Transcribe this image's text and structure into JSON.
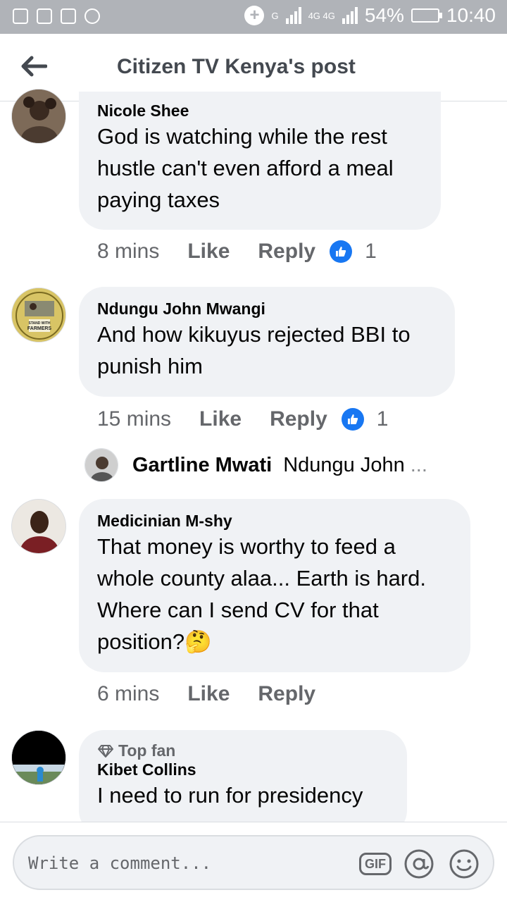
{
  "status_bar": {
    "network_1": "G",
    "network_2": "4G 4G",
    "battery": "54%",
    "battery_level": 0.54,
    "time": "10:40"
  },
  "header": {
    "title": "Citizen TV Kenya's post",
    "back_icon": "arrow-left-icon"
  },
  "comments": [
    {
      "author": "Nicole Shee",
      "text_lines": [
        "God is watching while the rest",
        "hustle can't even afford a meal",
        "paying taxes"
      ],
      "time": "8 mins",
      "like_label": "Like",
      "reply_label": "Reply",
      "reaction_count": "1"
    },
    {
      "author": "Ndungu John Mwangi",
      "avatar_text": [
        "STAND WITH",
        "FARMERS"
      ],
      "text_lines": [
        "And how kikuyus rejected BBI to",
        "punish him"
      ],
      "time": "15 mins",
      "like_label": "Like",
      "reply_label": "Reply",
      "reaction_count": "1",
      "reply_preview": {
        "author": "Gartline Mwati",
        "snippet": "Ndungu John",
        "ellipsis": "..."
      }
    },
    {
      "author": "Medicinian M-shy",
      "text_lines": [
        "That money is worthy to feed a",
        "whole county alaa... Earth is hard.",
        "Where can I send CV for that",
        "position?🤔"
      ],
      "time": "6 mins",
      "like_label": "Like",
      "reply_label": "Reply"
    },
    {
      "badge": "Top fan",
      "author": "Kibet Collins",
      "text_lines": [
        "I need to run for presidency"
      ]
    }
  ],
  "composer": {
    "placeholder": "Write a comment...",
    "gif_label": "GIF",
    "mention_icon": "at-sign-icon",
    "emoji_icon": "smiley-icon"
  },
  "colors": {
    "like_blue": "#1877f2",
    "status_bar": "#b0b3b8",
    "bubble": "#f0f2f5",
    "meta_text": "#65676b"
  }
}
